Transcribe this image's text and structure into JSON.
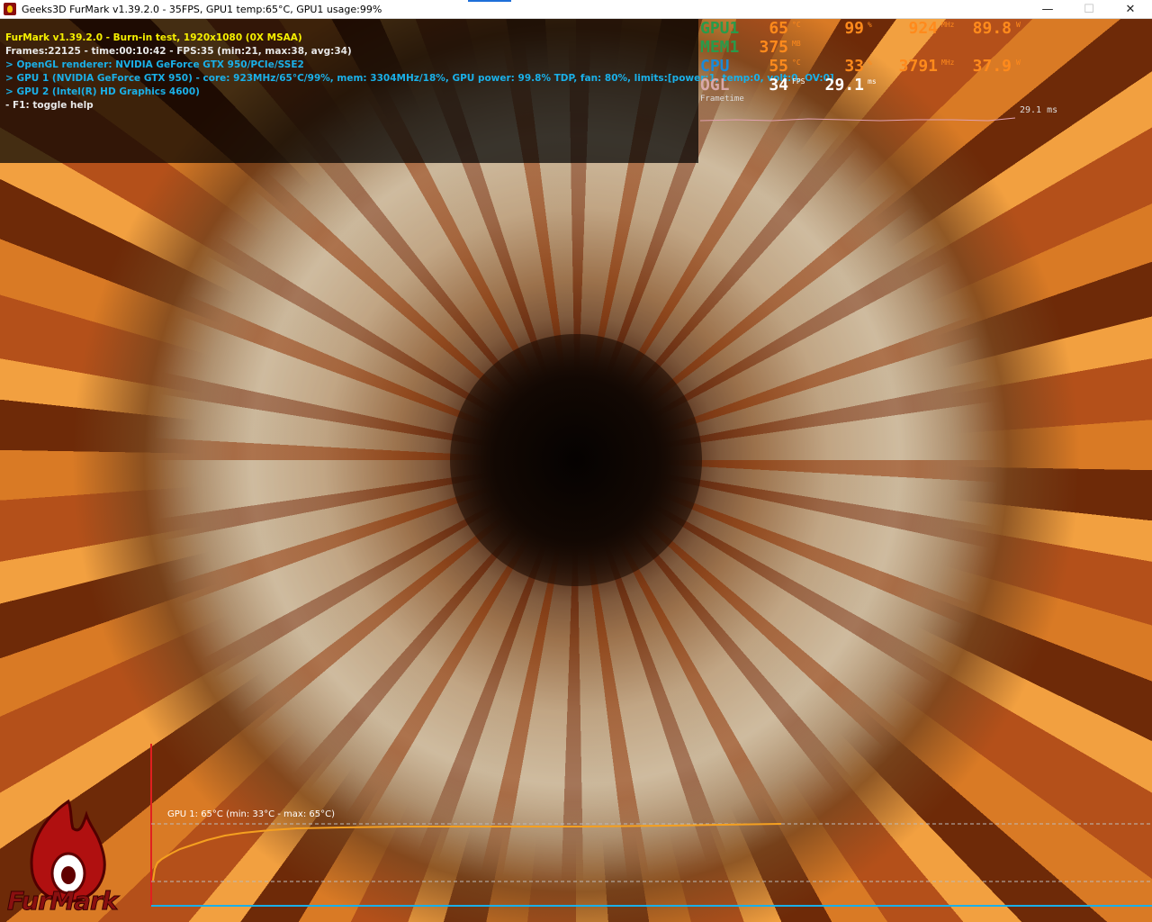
{
  "window": {
    "title": "Geeks3D FurMark v1.39.2.0 - 35FPS, GPU1 temp:65°C, GPU1 usage:99%",
    "minimize": "—",
    "maximize": "☐",
    "close": "✕"
  },
  "info": {
    "line1": "FurMark v1.39.2.0 - Burn-in test, 1920x1080 (0X MSAA)",
    "line2": "Frames:22125 - time:00:10:42 - FPS:35 (min:21, max:38, avg:34)",
    "line3": "> OpenGL renderer: NVIDIA GeForce GTX 950/PCIe/SSE2",
    "line4": "> GPU 1 (NVIDIA GeForce GTX 950) - core: 923MHz/65°C/99%, mem: 3304MHz/18%, GPU power: 99.8% TDP, fan: 80%, limits:[power:1, temp:0, volt:0, OV:0]",
    "line5": "> GPU 2 (Intel(R) HD Graphics 4600)",
    "line6": "- F1: toggle help"
  },
  "osd": {
    "gpu": {
      "label": "GPU1",
      "temp": "65",
      "temp_unit": "°C",
      "usage": "99",
      "usage_unit": "%",
      "clock": "924",
      "clock_unit": "MHz",
      "power": "89.8",
      "power_unit": "W"
    },
    "mem": {
      "label": "MEM1",
      "used": "375",
      "used_unit": "MB"
    },
    "cpu": {
      "label": "CPU",
      "temp": "55",
      "temp_unit": "°C",
      "usage": "33",
      "usage_unit": "%",
      "clock": "3791",
      "clock_unit": "MHz",
      "power": "37.9",
      "power_unit": "W"
    },
    "ogl": {
      "label": "OGL",
      "fps": "34",
      "fps_unit": "FPS",
      "frametime": "29.1",
      "frametime_unit": "ms"
    },
    "frametime_label": "Frametime",
    "frametime_readout": "29.1 ms"
  },
  "temp_graph": {
    "label": "GPU 1: 65°C (min: 33°C - max: 65°C)",
    "colors": {
      "line": "#f5a020",
      "axis": "#e02020",
      "baseline": "#1ab0e8"
    }
  },
  "logo": {
    "text": "FurMark"
  }
}
